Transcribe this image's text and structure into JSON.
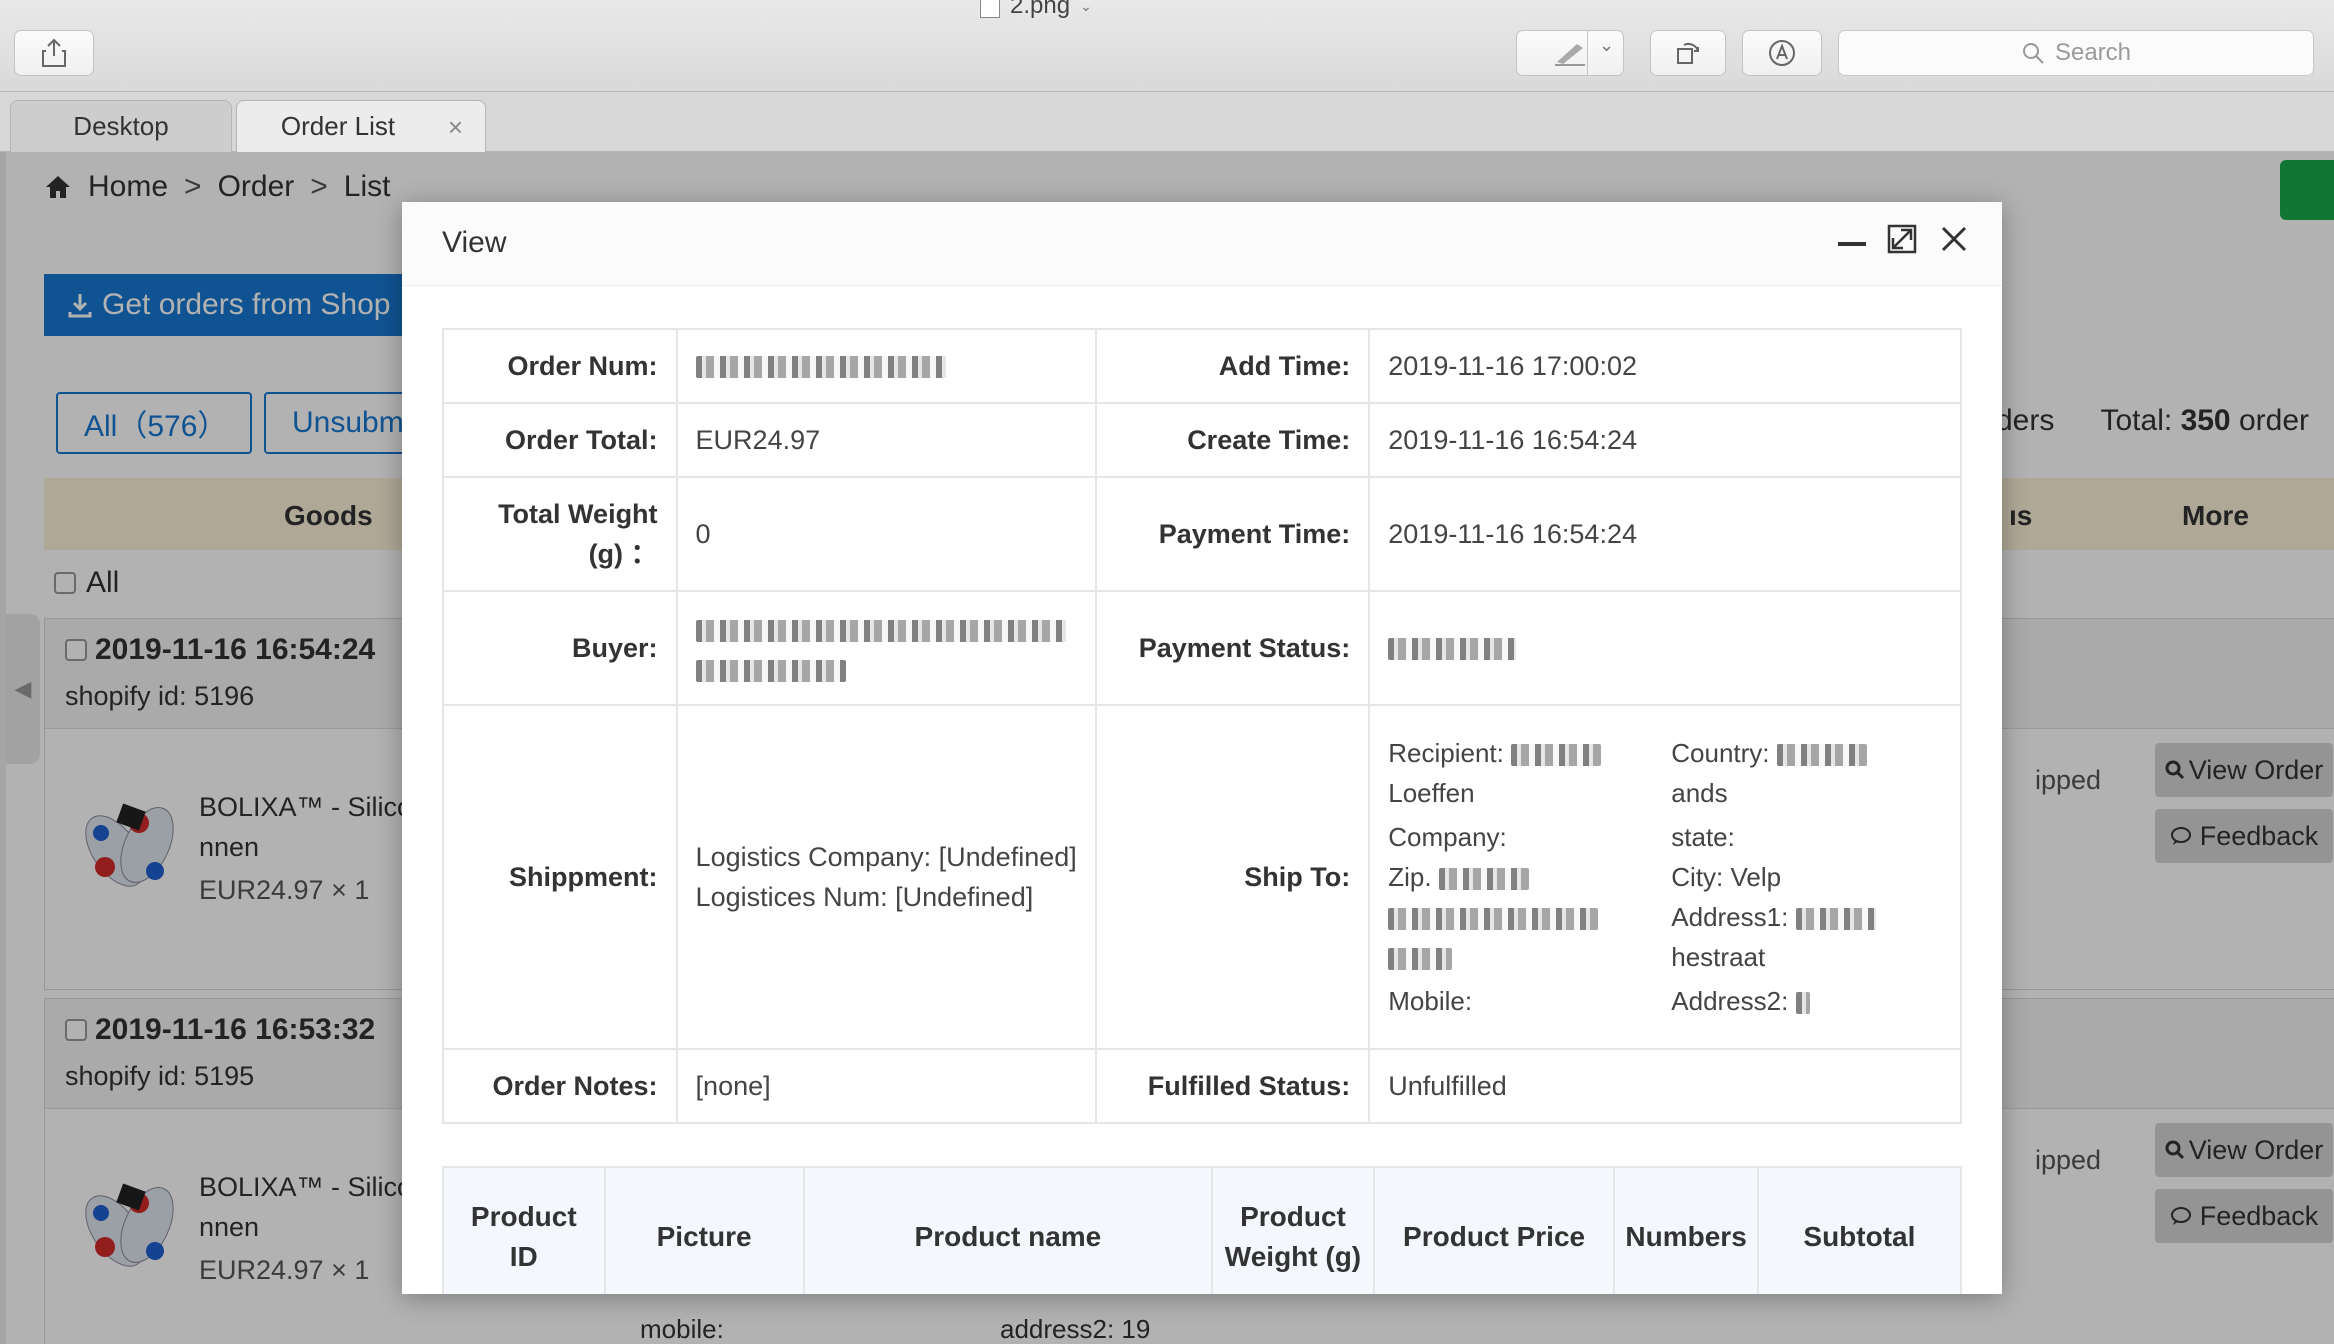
{
  "app": {
    "file_name": "2.png",
    "search_placeholder": "Search",
    "icons": [
      "share-icon",
      "markup-icon",
      "chevron-down-icon",
      "rotate-icon",
      "annotate-icon",
      "search-icon"
    ]
  },
  "tabs": [
    {
      "label": "Desktop"
    },
    {
      "label": "Order List",
      "close": "×"
    }
  ],
  "page": {
    "breadcrumb": [
      "Home",
      "Order",
      "List"
    ],
    "breadcrumb_sep": ">",
    "shop_button": "Get orders from Shop",
    "filters": [
      "All（576）",
      "Unsubm"
    ],
    "totals_partial": "ders",
    "totals_label": "Total:",
    "totals_value": "350",
    "totals_suffix": "order",
    "columns": {
      "goods": "Goods",
      "status_partial": "ıs",
      "more": "More"
    },
    "select_all": "All",
    "orders": [
      {
        "date": "2019-11-16 16:54:24",
        "shopify_id": "shopify id:  5196",
        "title_line1": "BOLIXA™ - Silicor",
        "title_line2": "nnen",
        "price": "EUR24.97  ×  1",
        "status": "ipped",
        "view_button": "View Order",
        "feedback_button": "Feedback"
      },
      {
        "date": "2019-11-16 16:53:32",
        "shopify_id": "shopify id:  5195",
        "title_line1": "BOLIXA™ - Silicor",
        "title_line2": "nnen",
        "price": "EUR24.97  ×  1",
        "status": "ipped",
        "view_button": "View Order",
        "feedback_button": "Feedback"
      }
    ],
    "behind_modal": {
      "mobile": "mobile:",
      "address2": "address2:  19"
    }
  },
  "modal": {
    "title": "View",
    "rows": {
      "order_num_label": "Order Num:",
      "add_time_label": "Add Time:",
      "add_time": "2019-11-16 17:00:02",
      "order_total_label": "Order Total:",
      "order_total": "EUR24.97",
      "create_time_label": "Create Time:",
      "create_time": "2019-11-16 16:54:24",
      "total_weight_label": "Total Weight (g) ：",
      "total_weight": "0",
      "payment_time_label": "Payment Time:",
      "payment_time": "2019-11-16 16:54:24",
      "buyer_label": "Buyer:",
      "payment_status_label": "Payment Status:",
      "shipment_label": "Shippment:",
      "logistics_company": "Logistics Company:  [Undefined]",
      "logistics_num": "Logistices Num:  [Undefined]",
      "ship_to_label": "Ship To:",
      "order_notes_label": "Order Notes:",
      "order_notes": "[none]",
      "fulfilled_status_label": "Fulfilled Status:",
      "fulfilled_status": "Unfulfilled"
    },
    "ship_to": {
      "recipient": "Recipient:",
      "recipient_tail": "Loeffen",
      "country": "Country:",
      "country_tail": "ands",
      "company": "Company:",
      "state": "state:",
      "zip": "Zip.",
      "city": "City:  Velp",
      "address1": "Address1:",
      "address1_tail": "hestraat",
      "mobile": "Mobile:",
      "address2": "Address2:"
    },
    "product_columns": [
      "Product ID",
      "Picture",
      "Product name",
      "Product Weight (g)",
      "Product Price",
      "Numbers",
      "Subtotal"
    ]
  }
}
